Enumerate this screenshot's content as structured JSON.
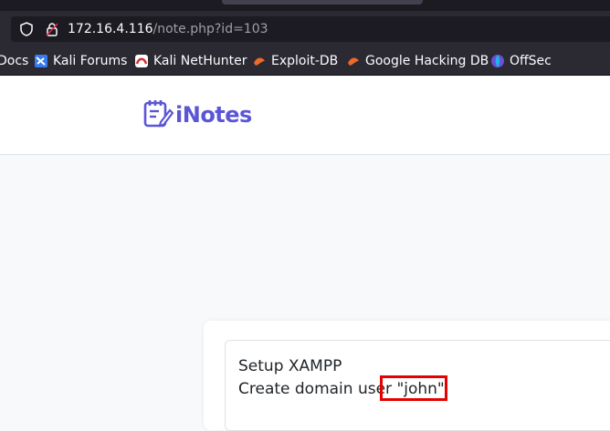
{
  "browser": {
    "url_host": "172.16.4.116",
    "url_path": "/note.php?id=103",
    "bookmarks": [
      {
        "label": "Docs",
        "icon": "doc-icon"
      },
      {
        "label": "Kali Forums",
        "icon": "kali-forums-icon"
      },
      {
        "label": "Kali NetHunter",
        "icon": "kali-nethunter-icon"
      },
      {
        "label": "Exploit-DB",
        "icon": "exploit-db-icon"
      },
      {
        "label": "Google Hacking DB",
        "icon": "ghdb-icon"
      },
      {
        "label": "OffSec",
        "icon": "offsec-icon"
      }
    ]
  },
  "site": {
    "logo_text": "iNotes",
    "logo_icon": "notepad-pencil-icon",
    "brand_color": "#5b56d6"
  },
  "note": {
    "line1": "Setup XAMPP",
    "line2": "Create domain user \"john\"",
    "highlight_color": "#e60000"
  }
}
